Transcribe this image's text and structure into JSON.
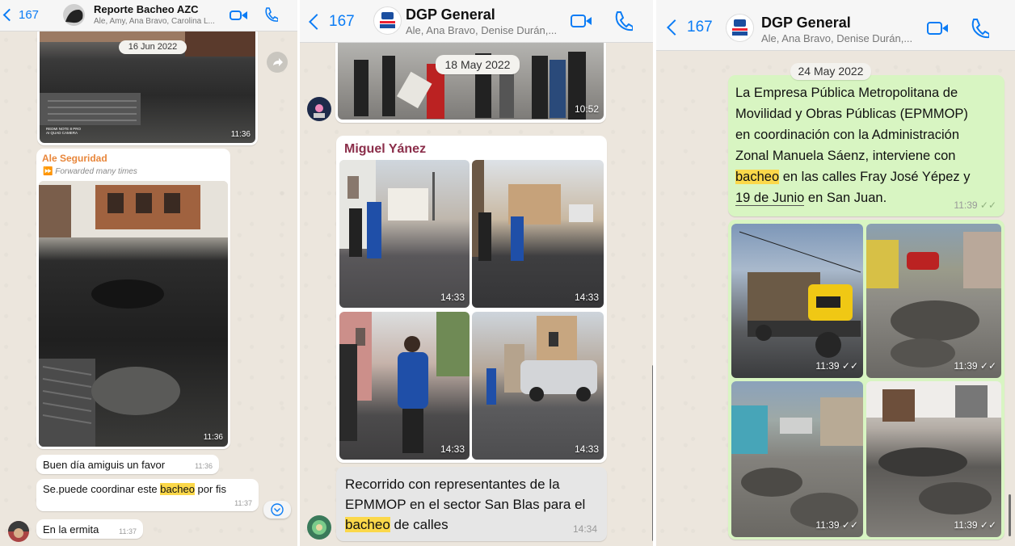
{
  "left": {
    "back_count": "167",
    "title": "Reporte Bacheo AZC",
    "subtitle": "Ale, Amy, Ana Bravo, Carolina L...",
    "date": "16 Jun 2022",
    "photo1_time": "11:36",
    "watermark_line1": "REDMI NOTE 8 PRO",
    "watermark_line2": "AI QUAD CAMERA",
    "sender": "Ale Seguridad",
    "forwarded": "Forwarded many times",
    "photo2_time": "11:36",
    "msg1": {
      "text": "Buen día amiguis un favor",
      "time": "11:36"
    },
    "msg2": {
      "pre": "Se.puede coordinar este ",
      "highlight": "bacheo",
      "post": " por fis",
      "time": "11:37"
    },
    "msg3": {
      "text": "En la ermita",
      "time": "11:37"
    }
  },
  "middle": {
    "back_count": "167",
    "title": "DGP General",
    "subtitle": "Ale, Ana Bravo, Denise Durán,...",
    "date": "18 May 2022",
    "top_photo_time": "10:52",
    "sender": "Miguel Yánez",
    "grid_times": [
      "14:33",
      "14:33",
      "14:33",
      "14:33"
    ],
    "caption": {
      "line1": "Recorrido con representantes de la",
      "line2": "EPMMOP en el sector San Blas para el",
      "highlight": "bacheo",
      "post": " de calles",
      "time": "14:34"
    }
  },
  "right": {
    "back_count": "167",
    "title": "DGP General",
    "subtitle": "Ale, Ana Bravo, Denise Durán,...",
    "date": "24 May 2022",
    "text": {
      "line1": "La Empresa Pública Metropolitana de",
      "line2": "Movilidad y Obras Públicas (EPMMOP)",
      "line3": "en coordinación con la Administración",
      "line4": "Zonal Manuela Sáenz, interviene con",
      "hl": "bacheo",
      "line5_post": " en las calles Fray José Yépez y",
      "line6_ul": "19 de Junio",
      "line6_post": " en San Juan.",
      "time": "11:39"
    },
    "grid_times": [
      "11:39",
      "11:39",
      "11:39",
      "11:39"
    ]
  },
  "colors": {
    "accent": "#0b7cf5",
    "green_bubble": "#d8f5c2",
    "highlight": "#fbd84a",
    "sender_orange": "#e8863a",
    "sender_maroon": "#8b2e4a"
  }
}
